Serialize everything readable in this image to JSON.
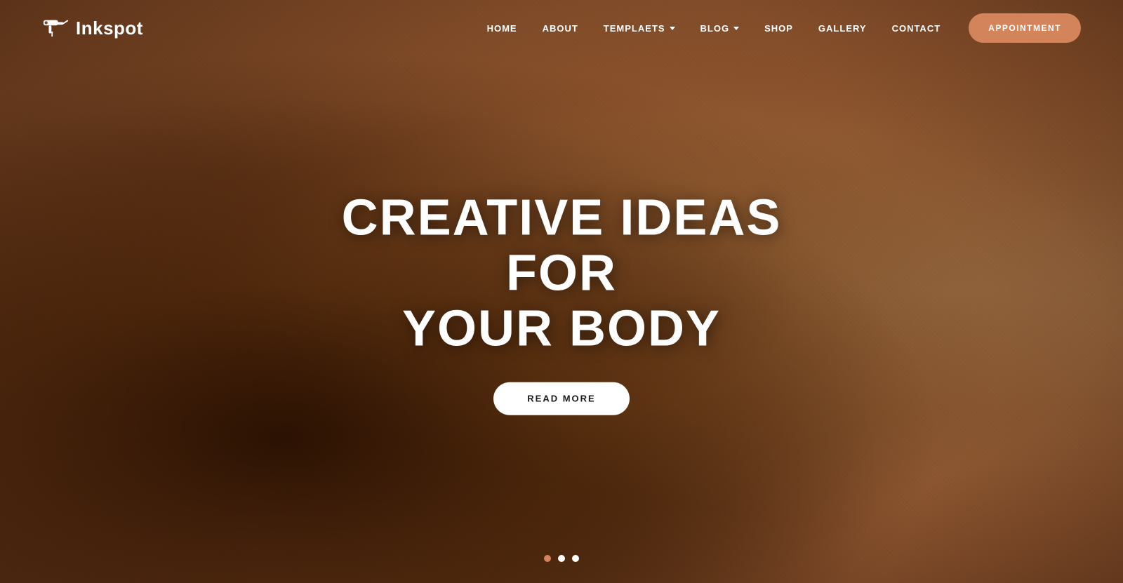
{
  "brand": {
    "logo_text": "Inkspot",
    "logo_icon_label": "tattoo-gun-icon"
  },
  "nav": {
    "links": [
      {
        "label": "HOME",
        "has_dropdown": false
      },
      {
        "label": "ABOUT",
        "has_dropdown": false
      },
      {
        "label": "TEMPLAETS",
        "has_dropdown": true
      },
      {
        "label": "BLOG",
        "has_dropdown": true
      },
      {
        "label": "SHOP",
        "has_dropdown": false
      },
      {
        "label": "GALLERY",
        "has_dropdown": false
      },
      {
        "label": "CONTACT",
        "has_dropdown": false
      }
    ],
    "cta_label": "APPOINTMENT",
    "colors": {
      "cta_bg": "#d4845a"
    }
  },
  "hero": {
    "title_line1": "CREATIVE IDEAS FOR",
    "title_line2": "YOUR BODY",
    "cta_label": "READ MORE"
  },
  "slider": {
    "dots": [
      {
        "state": "active"
      },
      {
        "state": "filled"
      },
      {
        "state": "filled"
      }
    ]
  }
}
